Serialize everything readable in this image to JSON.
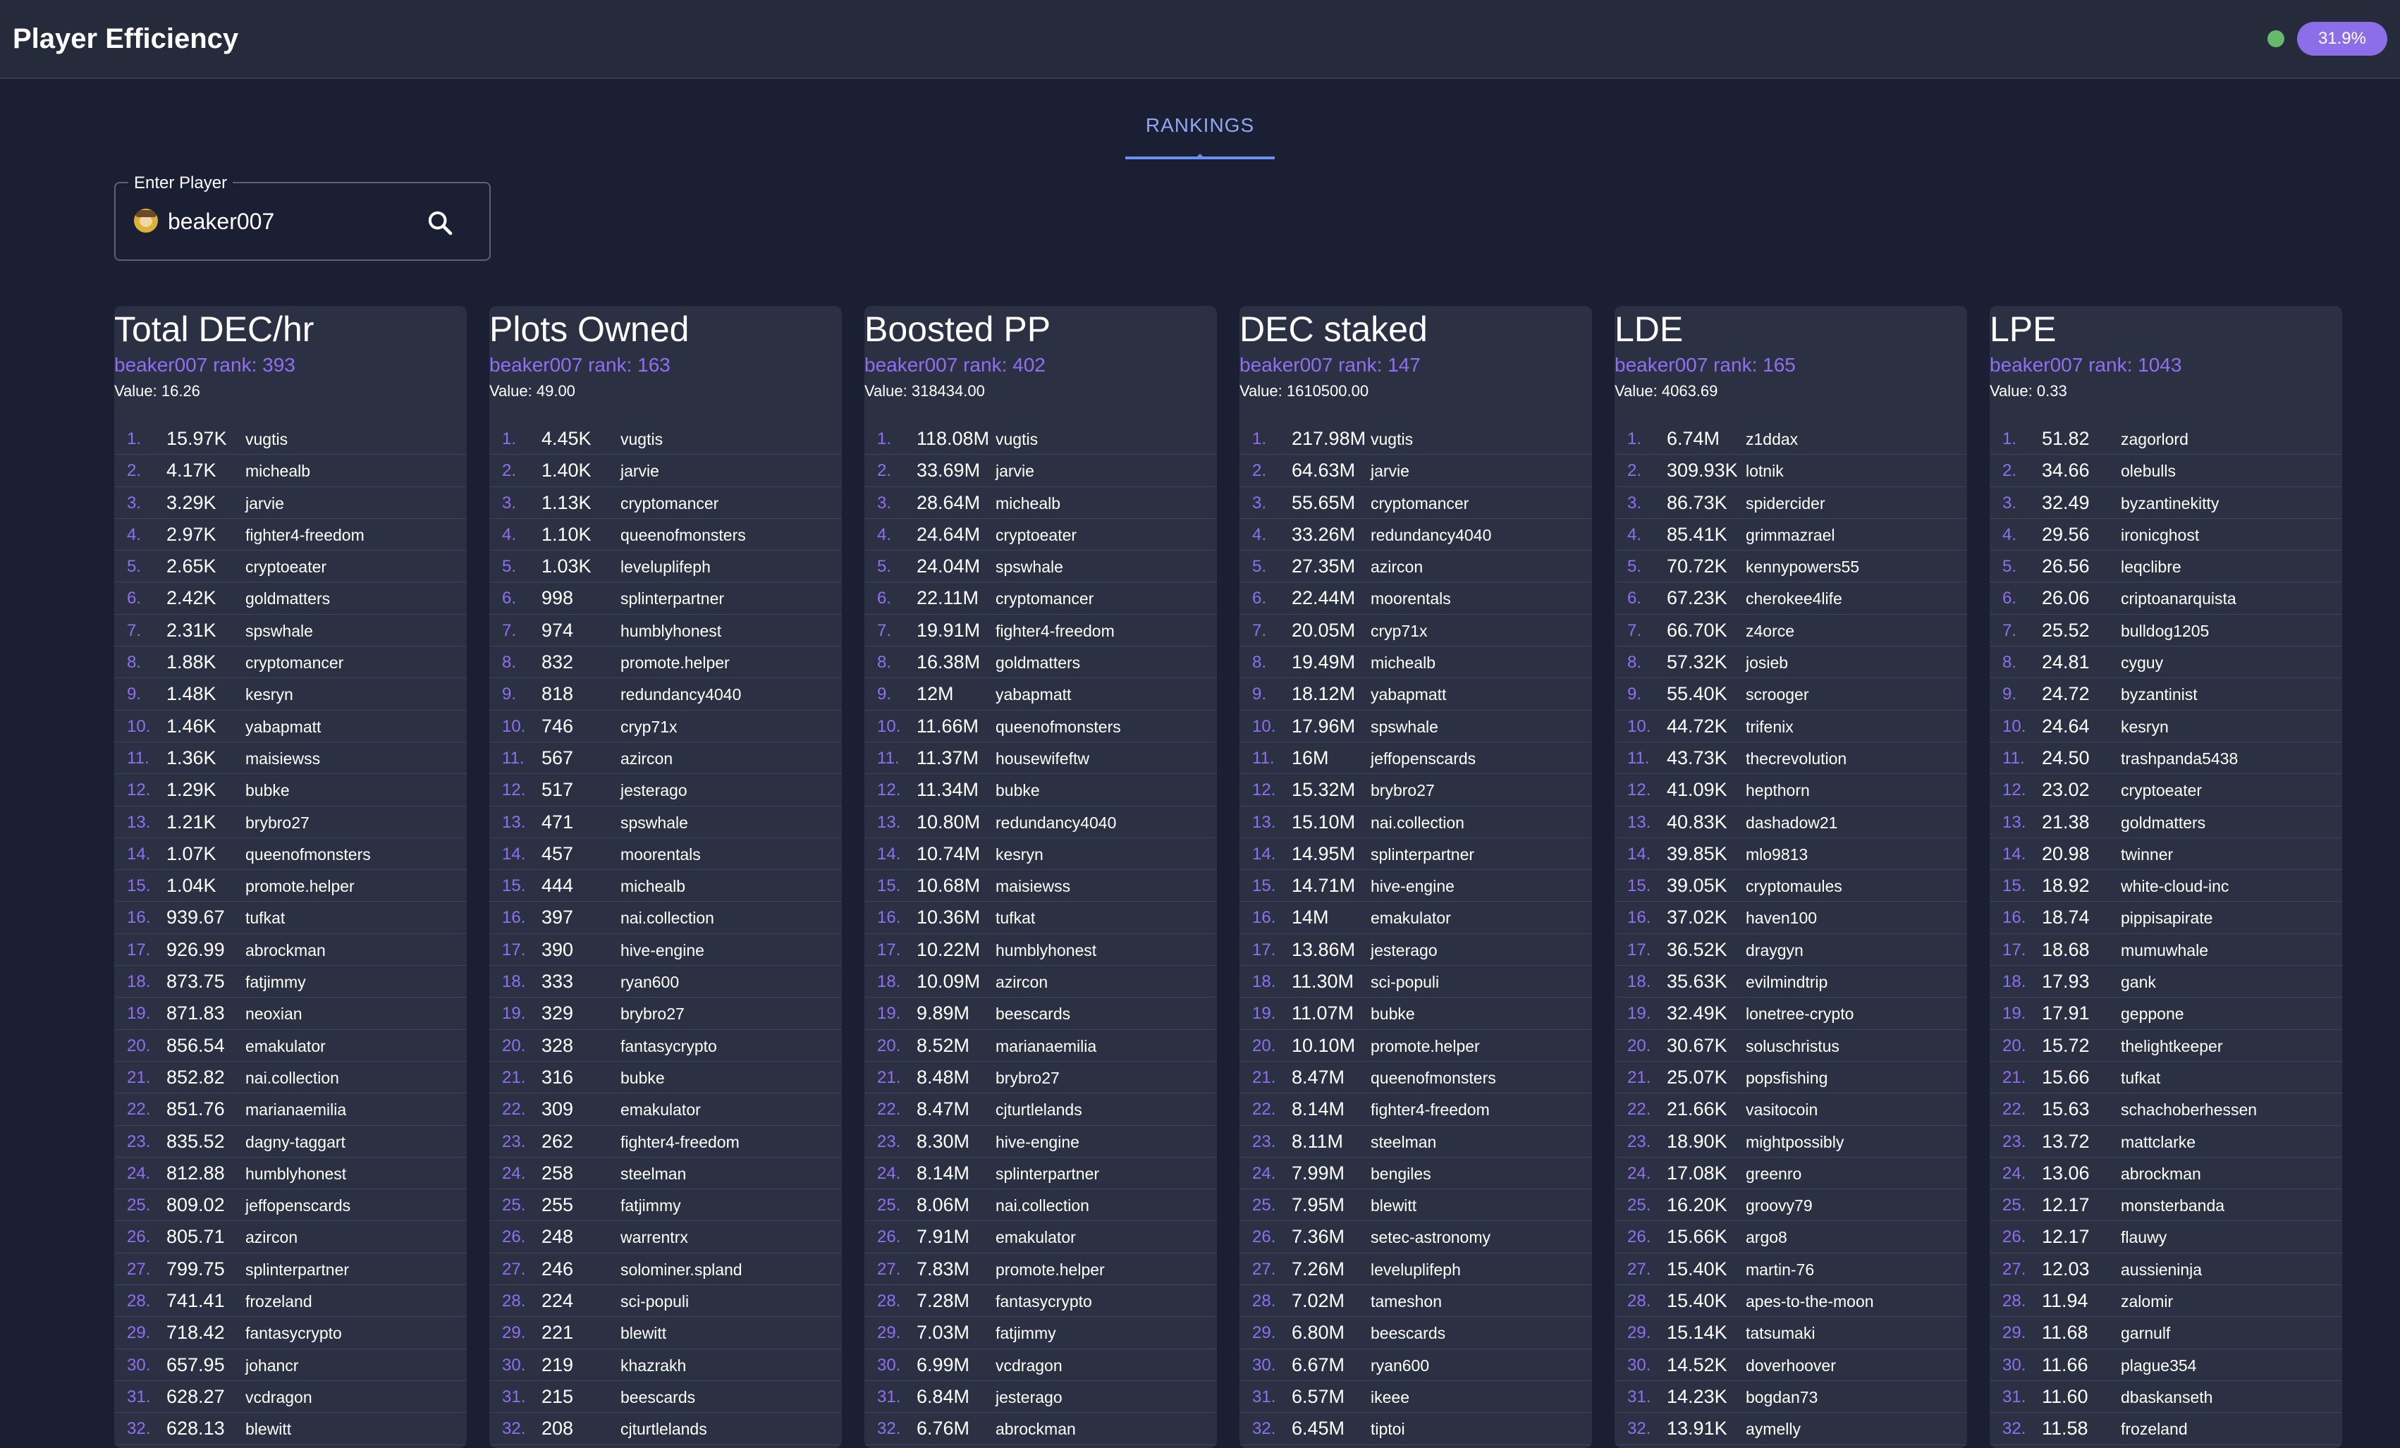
{
  "header": {
    "title": "Player Efficiency",
    "percent": "31.9%",
    "status_color": "#66bb6a",
    "accent": "#8c6fe8"
  },
  "tabs": [
    {
      "label": "RANKINGS"
    }
  ],
  "search": {
    "legend": "Enter Player",
    "value": "beaker007"
  },
  "columns": [
    {
      "title": "Total DEC/hr",
      "rank": "beaker007 rank: 393",
      "value": "Value: 16.26",
      "rows": [
        [
          "1.",
          "15.97K",
          "vugtis"
        ],
        [
          "2.",
          "4.17K",
          "michealb"
        ],
        [
          "3.",
          "3.29K",
          "jarvie"
        ],
        [
          "4.",
          "2.97K",
          "fighter4-freedom"
        ],
        [
          "5.",
          "2.65K",
          "cryptoeater"
        ],
        [
          "6.",
          "2.42K",
          "goldmatters"
        ],
        [
          "7.",
          "2.31K",
          "spswhale"
        ],
        [
          "8.",
          "1.88K",
          "cryptomancer"
        ],
        [
          "9.",
          "1.48K",
          "kesryn"
        ],
        [
          "10.",
          "1.46K",
          "yabapmatt"
        ],
        [
          "11.",
          "1.36K",
          "maisiewss"
        ],
        [
          "12.",
          "1.29K",
          "bubke"
        ],
        [
          "13.",
          "1.21K",
          "brybro27"
        ],
        [
          "14.",
          "1.07K",
          "queenofmonsters"
        ],
        [
          "15.",
          "1.04K",
          "promote.helper"
        ],
        [
          "16.",
          "939.67",
          "tufkat"
        ],
        [
          "17.",
          "926.99",
          "abrockman"
        ],
        [
          "18.",
          "873.75",
          "fatjimmy"
        ],
        [
          "19.",
          "871.83",
          "neoxian"
        ],
        [
          "20.",
          "856.54",
          "emakulator"
        ],
        [
          "21.",
          "852.82",
          "nai.collection"
        ],
        [
          "22.",
          "851.76",
          "marianaemilia"
        ],
        [
          "23.",
          "835.52",
          "dagny-taggart"
        ],
        [
          "24.",
          "812.88",
          "humblyhonest"
        ],
        [
          "25.",
          "809.02",
          "jeffopenscards"
        ],
        [
          "26.",
          "805.71",
          "azircon"
        ],
        [
          "27.",
          "799.75",
          "splinterpartner"
        ],
        [
          "28.",
          "741.41",
          "frozeland"
        ],
        [
          "29.",
          "718.42",
          "fantasycrypto"
        ],
        [
          "30.",
          "657.95",
          "johancr"
        ],
        [
          "31.",
          "628.27",
          "vcdragon"
        ],
        [
          "32.",
          "628.13",
          "blewitt"
        ]
      ]
    },
    {
      "title": "Plots Owned",
      "rank": "beaker007 rank: 163",
      "value": "Value: 49.00",
      "rows": [
        [
          "1.",
          "4.45K",
          "vugtis"
        ],
        [
          "2.",
          "1.40K",
          "jarvie"
        ],
        [
          "3.",
          "1.13K",
          "cryptomancer"
        ],
        [
          "4.",
          "1.10K",
          "queenofmonsters"
        ],
        [
          "5.",
          "1.03K",
          "leveluplifeph"
        ],
        [
          "6.",
          "998",
          "splinterpartner"
        ],
        [
          "7.",
          "974",
          "humblyhonest"
        ],
        [
          "8.",
          "832",
          "promote.helper"
        ],
        [
          "9.",
          "818",
          "redundancy4040"
        ],
        [
          "10.",
          "746",
          "cryp71x"
        ],
        [
          "11.",
          "567",
          "azircon"
        ],
        [
          "12.",
          "517",
          "jesterago"
        ],
        [
          "13.",
          "471",
          "spswhale"
        ],
        [
          "14.",
          "457",
          "moorentals"
        ],
        [
          "15.",
          "444",
          "michealb"
        ],
        [
          "16.",
          "397",
          "nai.collection"
        ],
        [
          "17.",
          "390",
          "hive-engine"
        ],
        [
          "18.",
          "333",
          "ryan600"
        ],
        [
          "19.",
          "329",
          "brybro27"
        ],
        [
          "20.",
          "328",
          "fantasycrypto"
        ],
        [
          "21.",
          "316",
          "bubke"
        ],
        [
          "22.",
          "309",
          "emakulator"
        ],
        [
          "23.",
          "262",
          "fighter4-freedom"
        ],
        [
          "24.",
          "258",
          "steelman"
        ],
        [
          "25.",
          "255",
          "fatjimmy"
        ],
        [
          "26.",
          "248",
          "warrentrx"
        ],
        [
          "27.",
          "246",
          "solominer.spland"
        ],
        [
          "28.",
          "224",
          "sci-populi"
        ],
        [
          "29.",
          "221",
          "blewitt"
        ],
        [
          "30.",
          "219",
          "khazrakh"
        ],
        [
          "31.",
          "215",
          "beescards"
        ],
        [
          "32.",
          "208",
          "cjturtlelands"
        ]
      ]
    },
    {
      "title": "Boosted PP",
      "rank": "beaker007 rank: 402",
      "value": "Value: 318434.00",
      "rows": [
        [
          "1.",
          "118.08M",
          "vugtis"
        ],
        [
          "2.",
          "33.69M",
          "jarvie"
        ],
        [
          "3.",
          "28.64M",
          "michealb"
        ],
        [
          "4.",
          "24.64M",
          "cryptoeater"
        ],
        [
          "5.",
          "24.04M",
          "spswhale"
        ],
        [
          "6.",
          "22.11M",
          "cryptomancer"
        ],
        [
          "7.",
          "19.91M",
          "fighter4-freedom"
        ],
        [
          "8.",
          "16.38M",
          "goldmatters"
        ],
        [
          "9.",
          "12M",
          "yabapmatt"
        ],
        [
          "10.",
          "11.66M",
          "queenofmonsters"
        ],
        [
          "11.",
          "11.37M",
          "housewifeftw"
        ],
        [
          "12.",
          "11.34M",
          "bubke"
        ],
        [
          "13.",
          "10.80M",
          "redundancy4040"
        ],
        [
          "14.",
          "10.74M",
          "kesryn"
        ],
        [
          "15.",
          "10.68M",
          "maisiewss"
        ],
        [
          "16.",
          "10.36M",
          "tufkat"
        ],
        [
          "17.",
          "10.22M",
          "humblyhonest"
        ],
        [
          "18.",
          "10.09M",
          "azircon"
        ],
        [
          "19.",
          "9.89M",
          "beescards"
        ],
        [
          "20.",
          "8.52M",
          "marianaemilia"
        ],
        [
          "21.",
          "8.48M",
          "brybro27"
        ],
        [
          "22.",
          "8.47M",
          "cjturtlelands"
        ],
        [
          "23.",
          "8.30M",
          "hive-engine"
        ],
        [
          "24.",
          "8.14M",
          "splinterpartner"
        ],
        [
          "25.",
          "8.06M",
          "nai.collection"
        ],
        [
          "26.",
          "7.91M",
          "emakulator"
        ],
        [
          "27.",
          "7.83M",
          "promote.helper"
        ],
        [
          "28.",
          "7.28M",
          "fantasycrypto"
        ],
        [
          "29.",
          "7.03M",
          "fatjimmy"
        ],
        [
          "30.",
          "6.99M",
          "vcdragon"
        ],
        [
          "31.",
          "6.84M",
          "jesterago"
        ],
        [
          "32.",
          "6.76M",
          "abrockman"
        ]
      ]
    },
    {
      "title": "DEC staked",
      "rank": "beaker007 rank: 147",
      "value": "Value: 1610500.00",
      "rows": [
        [
          "1.",
          "217.98M",
          "vugtis"
        ],
        [
          "2.",
          "64.63M",
          "jarvie"
        ],
        [
          "3.",
          "55.65M",
          "cryptomancer"
        ],
        [
          "4.",
          "33.26M",
          "redundancy4040"
        ],
        [
          "5.",
          "27.35M",
          "azircon"
        ],
        [
          "6.",
          "22.44M",
          "moorentals"
        ],
        [
          "7.",
          "20.05M",
          "cryp71x"
        ],
        [
          "8.",
          "19.49M",
          "michealb"
        ],
        [
          "9.",
          "18.12M",
          "yabapmatt"
        ],
        [
          "10.",
          "17.96M",
          "spswhale"
        ],
        [
          "11.",
          "16M",
          "jeffopenscards"
        ],
        [
          "12.",
          "15.32M",
          "brybro27"
        ],
        [
          "13.",
          "15.10M",
          "nai.collection"
        ],
        [
          "14.",
          "14.95M",
          "splinterpartner"
        ],
        [
          "15.",
          "14.71M",
          "hive-engine"
        ],
        [
          "16.",
          "14M",
          "emakulator"
        ],
        [
          "17.",
          "13.86M",
          "jesterago"
        ],
        [
          "18.",
          "11.30M",
          "sci-populi"
        ],
        [
          "19.",
          "11.07M",
          "bubke"
        ],
        [
          "20.",
          "10.10M",
          "promote.helper"
        ],
        [
          "21.",
          "8.47M",
          "queenofmonsters"
        ],
        [
          "22.",
          "8.14M",
          "fighter4-freedom"
        ],
        [
          "23.",
          "8.11M",
          "steelman"
        ],
        [
          "24.",
          "7.99M",
          "bengiles"
        ],
        [
          "25.",
          "7.95M",
          "blewitt"
        ],
        [
          "26.",
          "7.36M",
          "setec-astronomy"
        ],
        [
          "27.",
          "7.26M",
          "leveluplifeph"
        ],
        [
          "28.",
          "7.02M",
          "tameshon"
        ],
        [
          "29.",
          "6.80M",
          "beescards"
        ],
        [
          "30.",
          "6.67M",
          "ryan600"
        ],
        [
          "31.",
          "6.57M",
          "ikeee"
        ],
        [
          "32.",
          "6.45M",
          "tiptoi"
        ]
      ]
    },
    {
      "title": "LDE",
      "rank": "beaker007 rank: 165",
      "value": "Value: 4063.69",
      "rows": [
        [
          "1.",
          "6.74M",
          "z1ddax"
        ],
        [
          "2.",
          "309.93K",
          "lotnik"
        ],
        [
          "3.",
          "86.73K",
          "spidercider"
        ],
        [
          "4.",
          "85.41K",
          "grimmazrael"
        ],
        [
          "5.",
          "70.72K",
          "kennypowers55"
        ],
        [
          "6.",
          "67.23K",
          "cherokee4life"
        ],
        [
          "7.",
          "66.70K",
          "z4orce"
        ],
        [
          "8.",
          "57.32K",
          "josieb"
        ],
        [
          "9.",
          "55.40K",
          "scrooger"
        ],
        [
          "10.",
          "44.72K",
          "trifenix"
        ],
        [
          "11.",
          "43.73K",
          "thecrevolution"
        ],
        [
          "12.",
          "41.09K",
          "hepthorn"
        ],
        [
          "13.",
          "40.83K",
          "dashadow21"
        ],
        [
          "14.",
          "39.85K",
          "mlo9813"
        ],
        [
          "15.",
          "39.05K",
          "cryptomaules"
        ],
        [
          "16.",
          "37.02K",
          "haven100"
        ],
        [
          "17.",
          "36.52K",
          "draygyn"
        ],
        [
          "18.",
          "35.63K",
          "evilmindtrip"
        ],
        [
          "19.",
          "32.49K",
          "lonetree-crypto"
        ],
        [
          "20.",
          "30.67K",
          "soluschristus"
        ],
        [
          "21.",
          "25.07K",
          "popsfishing"
        ],
        [
          "22.",
          "21.66K",
          "vasitocoin"
        ],
        [
          "23.",
          "18.90K",
          "mightpossibly"
        ],
        [
          "24.",
          "17.08K",
          "greenro"
        ],
        [
          "25.",
          "16.20K",
          "groovy79"
        ],
        [
          "26.",
          "15.66K",
          "argo8"
        ],
        [
          "27.",
          "15.40K",
          "martin-76"
        ],
        [
          "28.",
          "15.40K",
          "apes-to-the-moon"
        ],
        [
          "29.",
          "15.14K",
          "tatsumaki"
        ],
        [
          "30.",
          "14.52K",
          "doverhoover"
        ],
        [
          "31.",
          "14.23K",
          "bogdan73"
        ],
        [
          "32.",
          "13.91K",
          "aymelly"
        ]
      ]
    },
    {
      "title": "LPE",
      "rank": "beaker007 rank: 1043",
      "value": "Value: 0.33",
      "rows": [
        [
          "1.",
          "51.82",
          "zagorlord"
        ],
        [
          "2.",
          "34.66",
          "olebulls"
        ],
        [
          "3.",
          "32.49",
          "byzantinekitty"
        ],
        [
          "4.",
          "29.56",
          "ironicghost"
        ],
        [
          "5.",
          "26.56",
          "leqclibre"
        ],
        [
          "6.",
          "26.06",
          "criptoanarquista"
        ],
        [
          "7.",
          "25.52",
          "bulldog1205"
        ],
        [
          "8.",
          "24.81",
          "cyguy"
        ],
        [
          "9.",
          "24.72",
          "byzantinist"
        ],
        [
          "10.",
          "24.64",
          "kesryn"
        ],
        [
          "11.",
          "24.50",
          "trashpanda5438"
        ],
        [
          "12.",
          "23.02",
          "cryptoeater"
        ],
        [
          "13.",
          "21.38",
          "goldmatters"
        ],
        [
          "14.",
          "20.98",
          "twinner"
        ],
        [
          "15.",
          "18.92",
          "white-cloud-inc"
        ],
        [
          "16.",
          "18.74",
          "pippisapirate"
        ],
        [
          "17.",
          "18.68",
          "mumuwhale"
        ],
        [
          "18.",
          "17.93",
          "gank"
        ],
        [
          "19.",
          "17.91",
          "geppone"
        ],
        [
          "20.",
          "15.72",
          "thelightkeeper"
        ],
        [
          "21.",
          "15.66",
          "tufkat"
        ],
        [
          "22.",
          "15.63",
          "schachoberhessen"
        ],
        [
          "23.",
          "13.72",
          "mattclarke"
        ],
        [
          "24.",
          "13.06",
          "abrockman"
        ],
        [
          "25.",
          "12.17",
          "monsterbanda"
        ],
        [
          "26.",
          "12.17",
          "flauwy"
        ],
        [
          "27.",
          "12.03",
          "aussieninja"
        ],
        [
          "28.",
          "11.94",
          "zalomir"
        ],
        [
          "29.",
          "11.68",
          "garnulf"
        ],
        [
          "30.",
          "11.66",
          "plague354"
        ],
        [
          "31.",
          "11.60",
          "dbaskanseth"
        ],
        [
          "32.",
          "11.58",
          "frozeland"
        ]
      ]
    }
  ]
}
